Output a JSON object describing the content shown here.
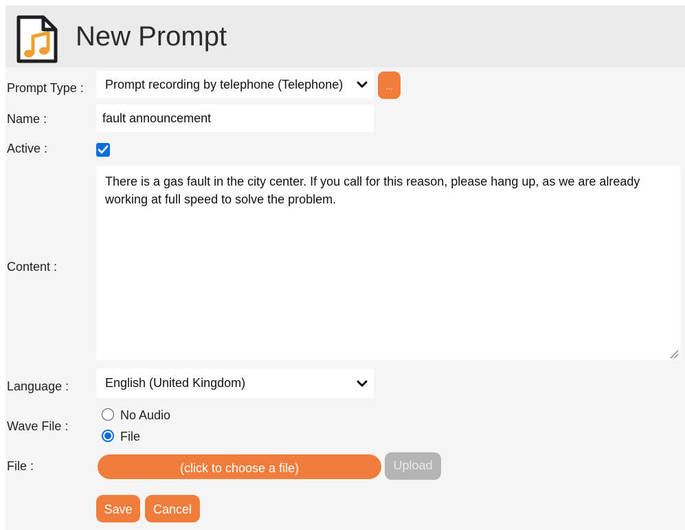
{
  "header": {
    "title": "New Prompt",
    "icon": "audio-file-icon"
  },
  "colors": {
    "accent": "#f07d3c",
    "disabled": "#b5b5b5",
    "check": "#0a6ddb",
    "header_bg": "#ebebeb",
    "page_bg": "#f5f5f5"
  },
  "form": {
    "prompt_type": {
      "label": "Prompt Type :",
      "value": "Prompt recording by telephone (Telephone)",
      "more_label": "..."
    },
    "name": {
      "label": "Name :",
      "value": "fault announcement"
    },
    "active": {
      "label": "Active :",
      "checked": true
    },
    "content": {
      "label": "Content :",
      "value": "There is a gas fault in the city center. If you call for this reason, please hang up, as we are already working at full speed to solve the problem."
    },
    "language": {
      "label": "Language :",
      "value": "English (United Kingdom)"
    },
    "wave_file": {
      "label": "Wave File :",
      "options": [
        {
          "label": "No Audio",
          "selected": false
        },
        {
          "label": "File",
          "selected": true
        }
      ]
    },
    "file": {
      "label": "File :",
      "choose_label": "(click to choose a file)",
      "upload_label": "Upload"
    }
  },
  "actions": {
    "save_label": "Save",
    "cancel_label": "Cancel"
  }
}
